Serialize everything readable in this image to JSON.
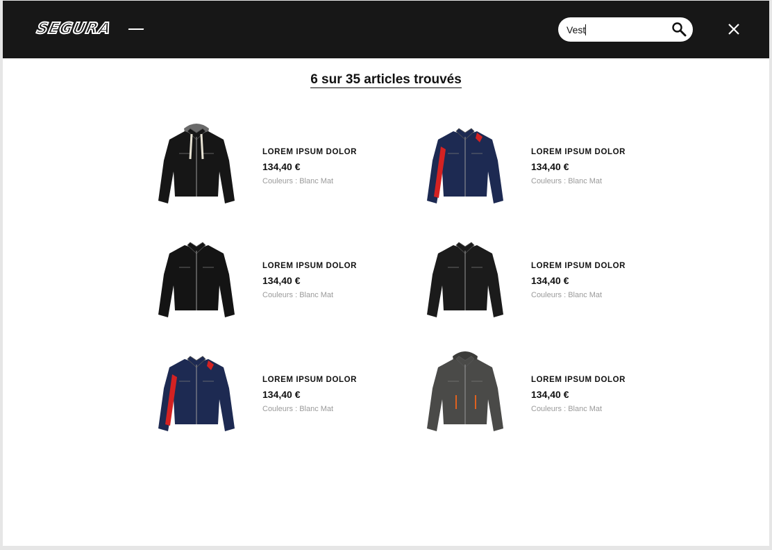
{
  "header": {
    "logo_text": "SEGURA",
    "search": {
      "value": "Vest",
      "placeholder": ""
    }
  },
  "results": {
    "summary": "6 sur 35 articles trouvés"
  },
  "products": [
    {
      "name": "LOREM IPSUM DOLOR",
      "price": "134,40 €",
      "colors": "Couleurs : Blanc Mat",
      "jacket_color": "#161616",
      "accent": "#e7e2d3",
      "hood": true
    },
    {
      "name": "LOREM IPSUM DOLOR",
      "price": "134,40 €",
      "colors": "Couleurs : Blanc Mat",
      "jacket_color": "#1d2a52",
      "accent": "#d42222",
      "hood": false
    },
    {
      "name": "LOREM IPSUM DOLOR",
      "price": "134,40 €",
      "colors": "Couleurs : Blanc Mat",
      "jacket_color": "#141414",
      "accent": "#3a3a3a",
      "hood": false
    },
    {
      "name": "LOREM IPSUM DOLOR",
      "price": "134,40 €",
      "colors": "Couleurs : Blanc Mat",
      "jacket_color": "#1b1b1b",
      "accent": "#444444",
      "hood": false
    },
    {
      "name": "LOREM IPSUM DOLOR",
      "price": "134,40 €",
      "colors": "Couleurs : Blanc Mat",
      "jacket_color": "#1d2a52",
      "accent": "#d42222",
      "hood": false
    },
    {
      "name": "LOREM IPSUM DOLOR",
      "price": "134,40 €",
      "colors": "Couleurs : Blanc Mat",
      "jacket_color": "#4a4a48",
      "accent": "#e0621f",
      "hood": true
    }
  ],
  "colors": {
    "header_bg": "#171717",
    "page_bg": "#ffffff",
    "text": "#111111",
    "muted": "#9a9a9a"
  }
}
